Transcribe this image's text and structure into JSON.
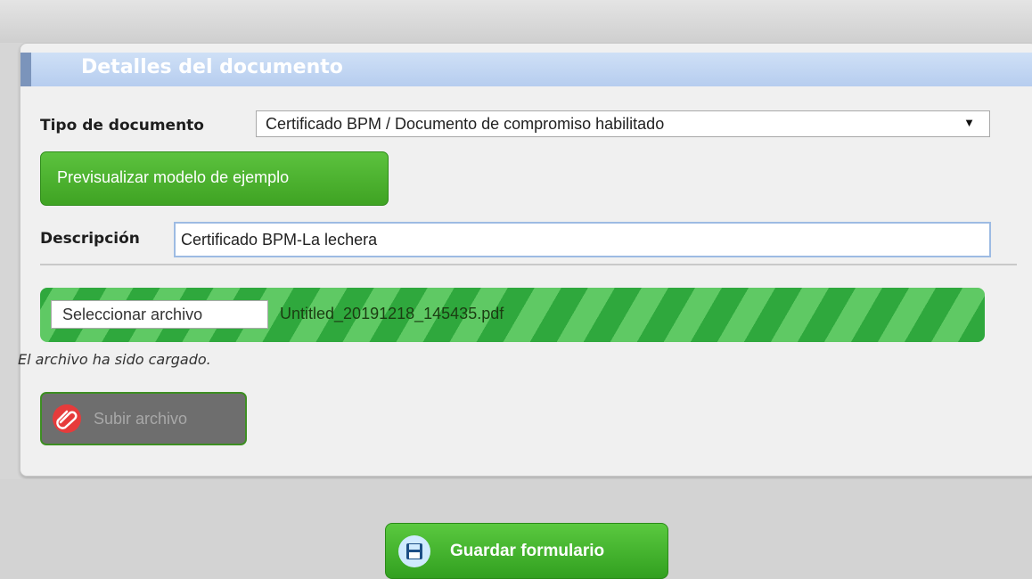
{
  "panel": {
    "title": "Detalles del documento"
  },
  "form": {
    "tipo_label": "Tipo de documento",
    "tipo_value": "Certificado BPM / Documento de compromiso habilitado",
    "preview_button": "Previsualizar modelo de ejemplo",
    "descripcion_label": "Descripción",
    "descripcion_value": "Certificado BPM-La lechera",
    "file_button": "Seleccionar archivo",
    "file_name": "Untitled_20191218_145435.pdf",
    "upload_status": "El archivo ha sido cargado.",
    "upload_button": "Subir archivo"
  },
  "footer": {
    "save_button": "Guardar formulario"
  },
  "icons": {
    "select_arrow": "chevron-down-icon",
    "paperclip": "paperclip-icon",
    "save": "floppy-disk-icon"
  },
  "colors": {
    "primary_green": "#3fa323",
    "header_blue": "#b6cdef",
    "upload_red": "#e63b3b"
  }
}
